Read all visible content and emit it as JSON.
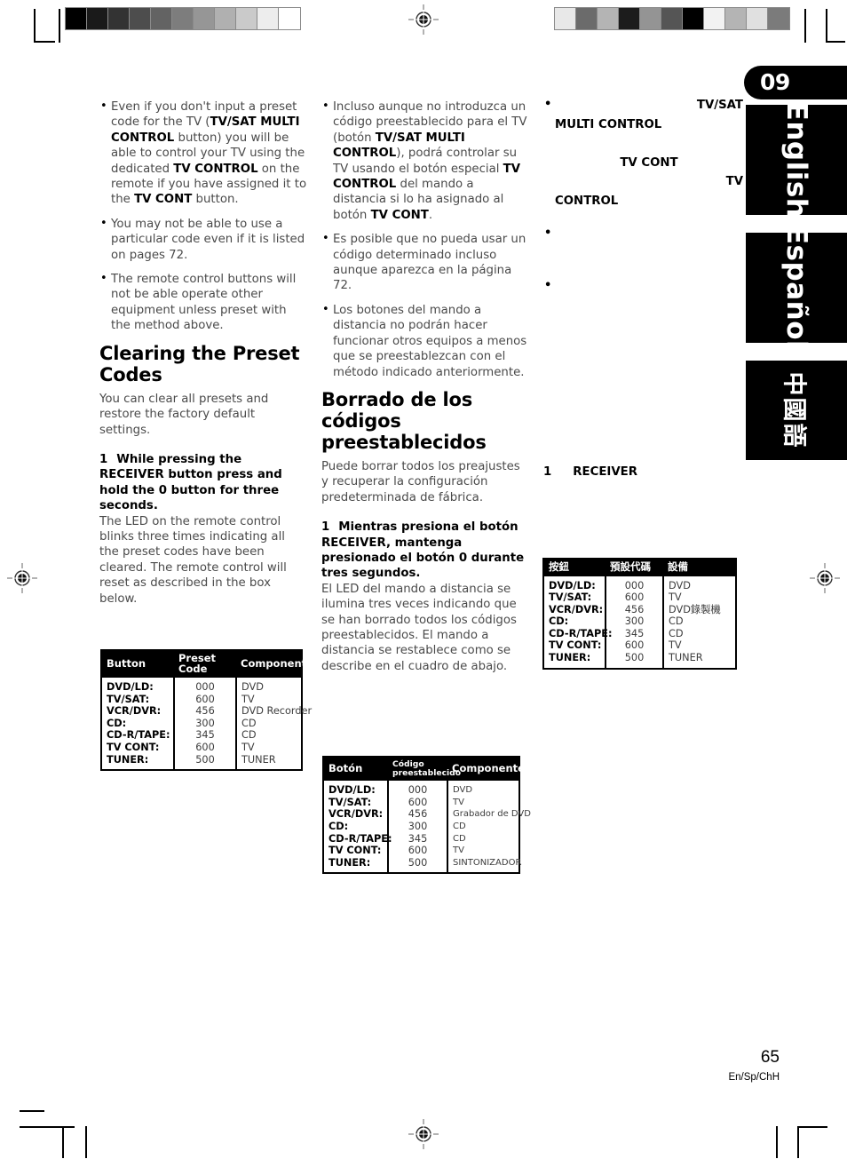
{
  "page": {
    "chapter_badge": "09",
    "number": "65",
    "edition": "En/Sp/ChH"
  },
  "language_tabs": [
    {
      "name": "english",
      "label": "English"
    },
    {
      "name": "espanol",
      "label": "Español"
    },
    {
      "name": "chinese",
      "label": "中國語"
    }
  ],
  "gray_bars": {
    "left_steps": [
      "#000000",
      "#1a1a1a",
      "#333333",
      "#4d4d4d",
      "#636363",
      "#7d7d7d",
      "#969696",
      "#b0b0b0",
      "#cacaca",
      "#ededed",
      "#ffffff"
    ],
    "right_steps": [
      "#e8e8e8",
      "#6b6b6b",
      "#b4b4b4",
      "#1c1c1c",
      "#949494",
      "#555555",
      "#000000",
      "#f2f2f2",
      "#b4b4b4",
      "#e0e0e0",
      "#7b7b7b"
    ]
  },
  "english": {
    "bullets": [
      {
        "parts": [
          {
            "t": "Even if you don't input a preset code for the TV (",
            "b": false
          },
          {
            "t": "TV/SAT MULTI CONTROL",
            "b": true
          },
          {
            "t": " button) you will be able to control your TV using the dedicated ",
            "b": false
          },
          {
            "t": "TV CONTROL",
            "b": true
          },
          {
            "t": " on the remote if you have assigned it to the ",
            "b": false
          },
          {
            "t": "TV CONT",
            "b": true
          },
          {
            "t": " button.",
            "b": false
          }
        ]
      },
      {
        "parts": [
          {
            "t": "You may not be able to use a particular code even if it is listed on pages 72.",
            "b": false
          }
        ]
      },
      {
        "parts": [
          {
            "t": "The remote control buttons will not be able operate other equipment unless preset with the method above.",
            "b": false
          }
        ]
      }
    ],
    "section_title": "Clearing the Preset Codes",
    "lead": "You can clear all presets and restore the factory default settings.",
    "step_number": "1",
    "step_title": "While pressing the RECEIVER button press and hold the 0 button for three seconds.",
    "step_body": "The LED on the remote control blinks three times indicating all the preset codes have been cleared. The remote control will reset as described in the box below.",
    "table": {
      "headers": [
        "Button",
        "Preset Code",
        "Component"
      ],
      "rows": [
        [
          "DVD/LD:",
          "000",
          "DVD"
        ],
        [
          "TV/SAT:",
          "600",
          "TV"
        ],
        [
          "VCR/DVR:",
          "456",
          "DVD Recorder"
        ],
        [
          "CD:",
          "300",
          "CD"
        ],
        [
          "CD-R/TAPE:",
          "345",
          "CD"
        ],
        [
          "TV CONT:",
          "600",
          "TV"
        ],
        [
          "TUNER:",
          "500",
          "TUNER"
        ]
      ]
    }
  },
  "spanish": {
    "bullets": [
      {
        "parts": [
          {
            "t": "Incluso aunque no introduzca un código preestablecido para el TV (botón ",
            "b": false
          },
          {
            "t": "TV/SAT MULTI CONTROL",
            "b": true
          },
          {
            "t": "), podrá controlar su TV usando el botón especial ",
            "b": false
          },
          {
            "t": "TV CONTROL",
            "b": true
          },
          {
            "t": " del mando a distancia si lo ha asignado al botón ",
            "b": false
          },
          {
            "t": "TV CONT",
            "b": true
          },
          {
            "t": ".",
            "b": false
          }
        ]
      },
      {
        "parts": [
          {
            "t": "Es posible que no pueda usar un código determinado incluso aunque aparezca en la página 72.",
            "b": false
          }
        ]
      },
      {
        "parts": [
          {
            "t": "Los botones del mando a distancia no podrán hacer funcionar otros equipos a menos que se preestablezcan con el método indicado anteriormente.",
            "b": false
          }
        ]
      }
    ],
    "section_title": "Borrado de los códigos preestablecidos",
    "lead": "Puede borrar todos los preajustes y recuperar la configuración predeterminada de fábrica.",
    "step_number": "1",
    "step_title": "Mientras presiona el botón RECEIVER, mantenga presionado el botón 0 durante tres segundos.",
    "step_body": "El LED del mando a distancia se ilumina tres veces indicando que se han borrado todos los códigos preestablecidos. El mando a distancia se restablece como se describe en el cuadro de abajo.",
    "table": {
      "headers": [
        "Botón",
        "Código preestablecido",
        "Componente"
      ],
      "rows": [
        [
          "DVD/LD:",
          "000",
          "DVD"
        ],
        [
          "TV/SAT:",
          "600",
          "TV"
        ],
        [
          "VCR/DVR:",
          "456",
          "Grabador de DVD"
        ],
        [
          "CD:",
          "300",
          "CD"
        ],
        [
          "CD-R/TAPE:",
          "345",
          "CD"
        ],
        [
          "TV CONT:",
          "600",
          "TV"
        ],
        [
          "TUNER:",
          "500",
          "SINTONIZADOR"
        ]
      ]
    }
  },
  "chinese": {
    "bullets": [
      {
        "lines": [
          {
            "t": "TV/SAT",
            "align": "right"
          },
          {
            "t": "MULTI CONTROL",
            "align": "left"
          },
          {
            "t": "",
            "align": "left"
          },
          {
            "t": "TV CONT",
            "align": "center"
          },
          {
            "t": "TV",
            "align": "right"
          },
          {
            "t": "CONTROL",
            "align": "left"
          }
        ]
      },
      {
        "lines": [
          {
            "t": "",
            "align": "left"
          },
          {
            "t": "",
            "align": "left"
          }
        ]
      },
      {
        "lines": [
          {
            "t": "",
            "align": "left"
          },
          {
            "t": "",
            "align": "left"
          },
          {
            "t": "",
            "align": "left"
          }
        ]
      }
    ],
    "step_number": "1",
    "step_title": "RECEIVER",
    "table": {
      "headers": [
        "按鈕",
        "預設代碼",
        "設備"
      ],
      "rows": [
        [
          "DVD/LD:",
          "000",
          "DVD"
        ],
        [
          "TV/SAT:",
          "600",
          "TV"
        ],
        [
          "VCR/DVR:",
          "456",
          "DVD錄製機"
        ],
        [
          "CD:",
          "300",
          "CD"
        ],
        [
          "CD-R/TAPE:",
          "345",
          "CD"
        ],
        [
          "TV CONT:",
          "600",
          "TV"
        ],
        [
          "TUNER:",
          "500",
          "TUNER"
        ]
      ]
    }
  }
}
